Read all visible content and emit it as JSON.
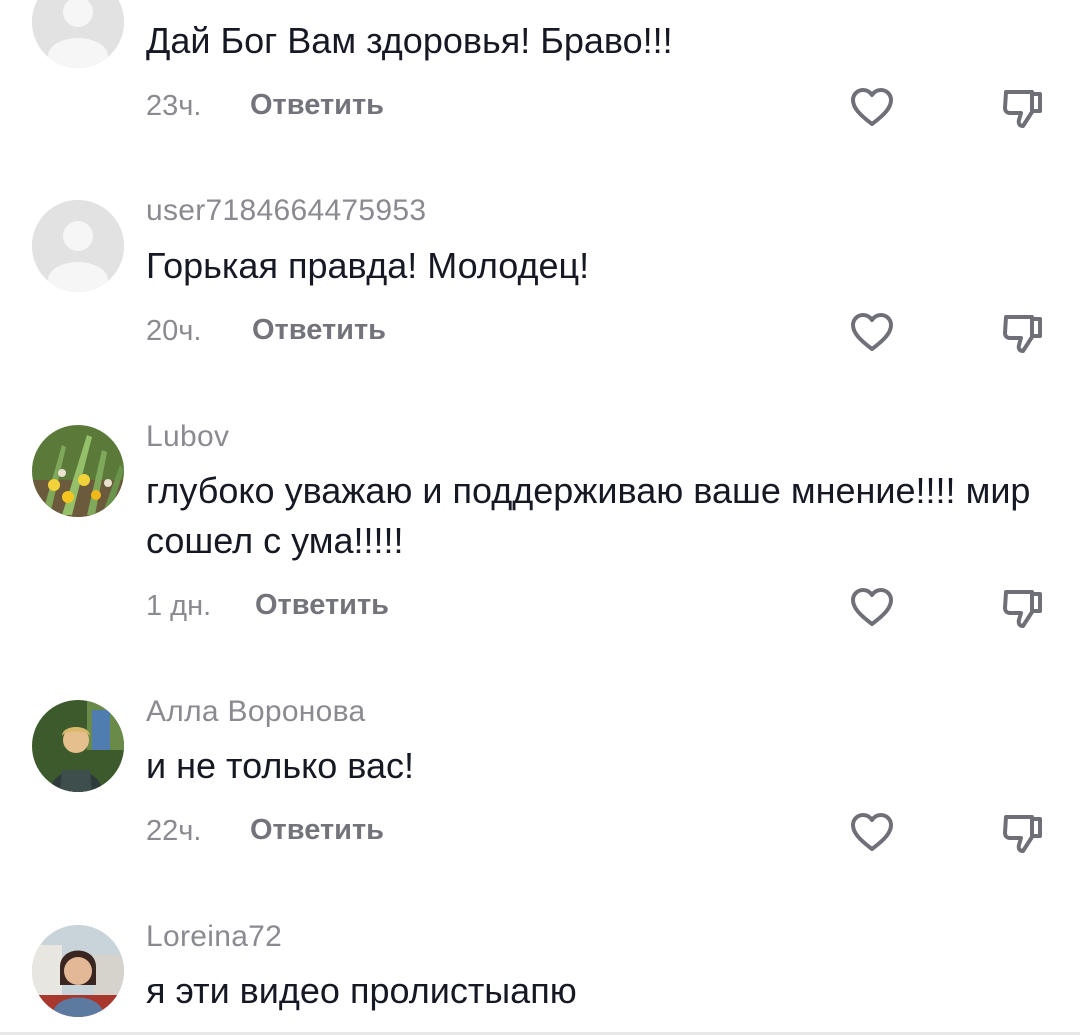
{
  "comments": [
    {
      "username": "",
      "text": "Дай Бог Вам здоровья! Браво!!!",
      "time": "23ч.",
      "reply_label": "Ответить",
      "avatar": "default-avatar"
    },
    {
      "username": "user7184664475953",
      "text": "Горькая правда! Молодец!",
      "time": "20ч.",
      "reply_label": "Ответить",
      "avatar": "default-avatar"
    },
    {
      "username": "Lubov",
      "text": "глубоко уважаю и поддерживаю ваше мнение!!!! мир сошел с ума!!!!!",
      "time": "1 дн.",
      "reply_label": "Ответить",
      "avatar": "flowers-photo"
    },
    {
      "username": "Алла Воронова",
      "text": "и не только вас!",
      "time": "22ч.",
      "reply_label": "Ответить",
      "avatar": "woman-photo"
    },
    {
      "username": "Loreina72",
      "text": "я эти видео пролистыапю",
      "time": "",
      "reply_label": "",
      "avatar": "woman-photo"
    }
  ],
  "colors": {
    "text": "#161823",
    "secondary": "#8a8b91",
    "reply": "#73747b",
    "icon": "#6f7077"
  }
}
